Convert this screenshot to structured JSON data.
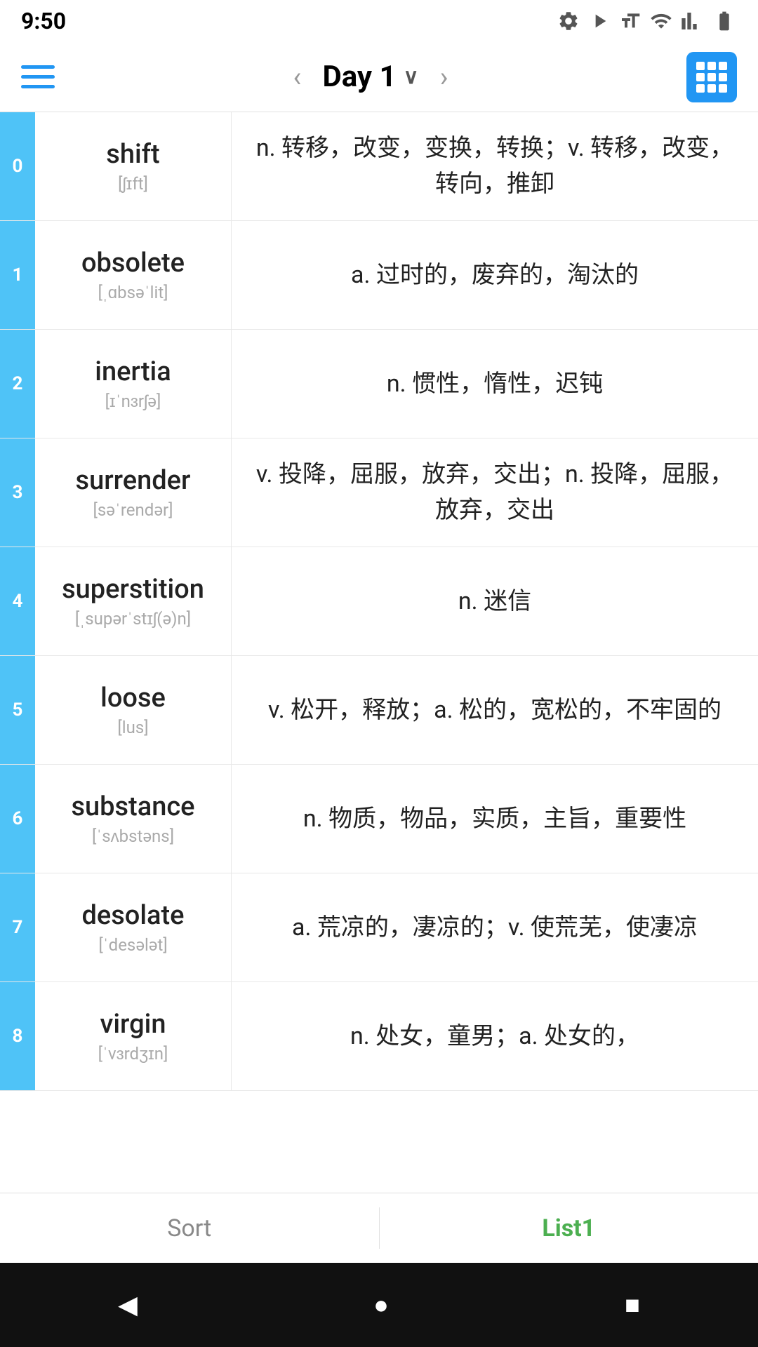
{
  "statusBar": {
    "time": "9:50",
    "icons": [
      "gear-icon",
      "play-icon",
      "font-icon",
      "wifi-icon",
      "signal-icon",
      "battery-icon"
    ]
  },
  "navbar": {
    "title": "Day 1",
    "prevLabel": "‹",
    "nextLabel": "›"
  },
  "words": [
    {
      "index": "0",
      "english": "shift",
      "phonetic": "[ʃɪft]",
      "definition": "n. 转移，改变，变换，转换；v. 转移，改变，转向，推卸"
    },
    {
      "index": "1",
      "english": "obsolete",
      "phonetic": "[ˌɑbsəˈlit]",
      "definition": "a. 过时的，废弃的，淘汰的"
    },
    {
      "index": "2",
      "english": "inertia",
      "phonetic": "[ɪˈnɜrʃə]",
      "definition": "n. 惯性，惰性，迟钝"
    },
    {
      "index": "3",
      "english": "surrender",
      "phonetic": "[səˈrendər]",
      "definition": "v. 投降，屈服，放弃，交出；n. 投降，屈服，放弃，交出"
    },
    {
      "index": "4",
      "english": "superstition",
      "phonetic": "[ˌsupərˈstɪʃ(ə)n]",
      "definition": "n. 迷信"
    },
    {
      "index": "5",
      "english": "loose",
      "phonetic": "[lus]",
      "definition": "v. 松开，释放；a. 松的，宽松的，不牢固的"
    },
    {
      "index": "6",
      "english": "substance",
      "phonetic": "[ˈsʌbstəns]",
      "definition": "n. 物质，物品，实质，主旨，重要性"
    },
    {
      "index": "7",
      "english": "desolate",
      "phonetic": "[ˈdesələt]",
      "definition": "a. 荒凉的，凄凉的；v. 使荒芜，使凄凉"
    },
    {
      "index": "8",
      "english": "virgin",
      "phonetic": "[ˈvɜrdʒɪn]",
      "definition": "n. 处女，童男；a. 处女的，"
    }
  ],
  "bottomTabs": {
    "sort": "Sort",
    "list1": "List1"
  },
  "androidNav": {
    "back": "◀",
    "home": "●",
    "recent": "■"
  }
}
